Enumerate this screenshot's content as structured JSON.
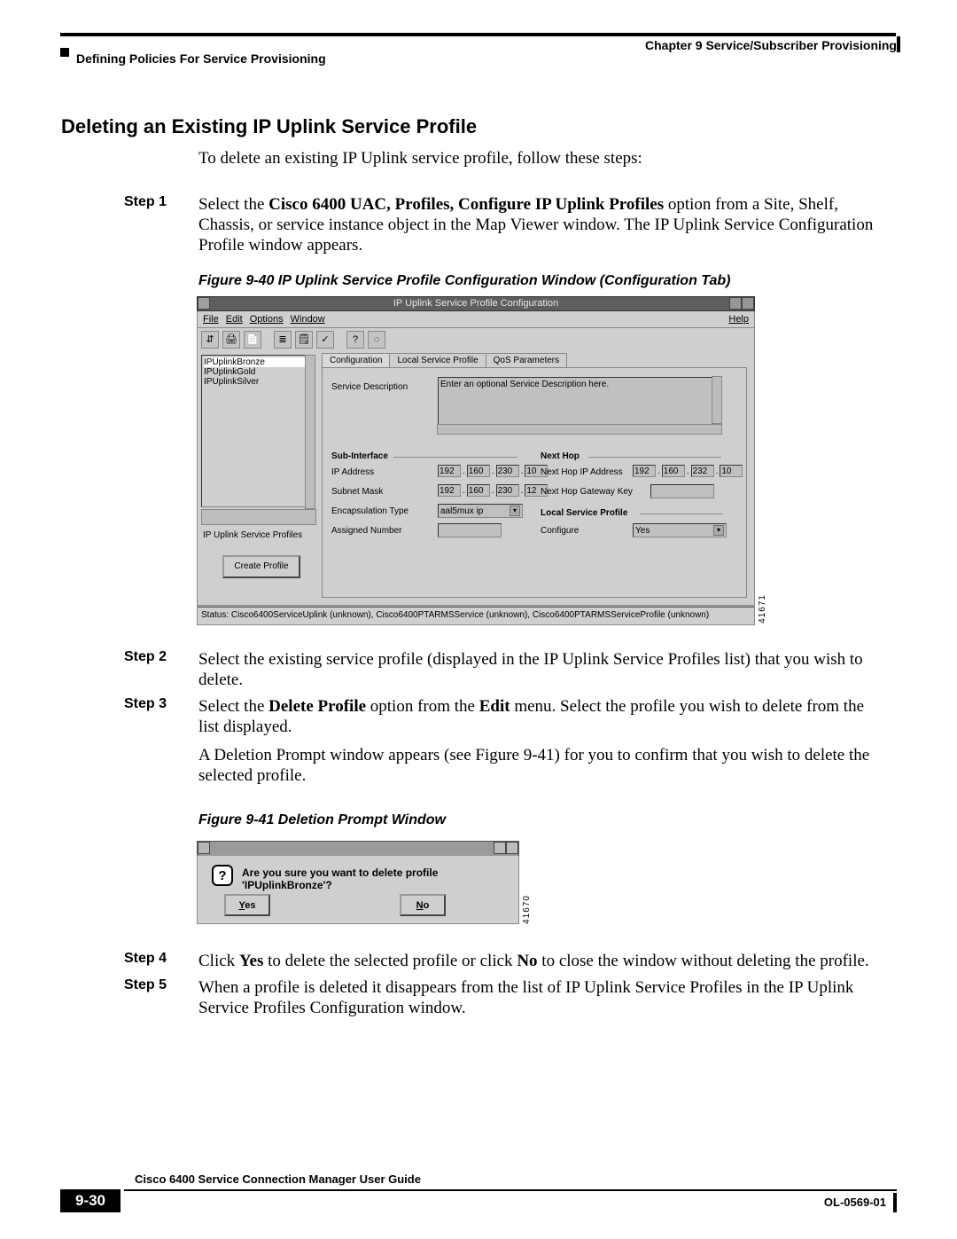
{
  "header": {
    "chapter": "Chapter 9    Service/Subscriber Provisioning",
    "section": "Defining Policies For Service Provisioning"
  },
  "heading": "Deleting an Existing IP Uplink Service Profile",
  "intro": "To delete an existing IP Uplink service profile, follow these steps:",
  "steps": {
    "s1_label": "Step 1",
    "s1_a": "Select the ",
    "s1_b": "Cisco 6400 UAC, Profiles, Configure IP Uplink Profiles",
    "s1_c": " option from a Site, Shelf, Chassis, or service instance object in the Map Viewer window. The IP Uplink Service Configuration Profile window appears.",
    "s2_label": "Step 2",
    "s2": "Select the existing service profile (displayed in the IP Uplink Service Profiles list) that you wish to delete.",
    "s3_label": "Step 3",
    "s3_a": "Select the ",
    "s3_b": "Delete Profile",
    "s3_c": " option from the ",
    "s3_d": "Edit",
    "s3_e": " menu. Select the profile you wish to delete from the list displayed.",
    "s3_p2": "A Deletion Prompt window appears (see Figure 9-41) for you to confirm that you wish to delete the selected profile.",
    "s4_label": "Step 4",
    "s4_a": "Click ",
    "s4_b": "Yes",
    "s4_c": " to delete the selected profile or click ",
    "s4_d": "No",
    "s4_e": " to close the window without deleting the profile.",
    "s5_label": "Step 5",
    "s5": "When a profile is deleted it disappears from the list of IP Uplink Service Profiles in the IP Uplink Service Profiles Configuration window."
  },
  "fig940": "Figure 9-40   IP Uplink Service Profile Configuration Window (Configuration Tab)",
  "fig941": "Figure 9-41   Deletion Prompt Window",
  "shot1": {
    "title": "IP Uplink Service Profile Configuration",
    "menu": {
      "file": "File",
      "edit": "Edit",
      "options": "Options",
      "window": "Window",
      "help": "Help"
    },
    "toolbar_icons": [
      "⇵",
      "🖨",
      "📄",
      "≣",
      "🗒",
      "✓",
      "?",
      "◌"
    ],
    "profiles": {
      "sel": "IPUplinkBronze",
      "p2": "IPUplinkGold",
      "p3": "IPUplinkSilver"
    },
    "left_label": "IP Uplink Service Profiles",
    "create_btn": "Create Profile",
    "tabs": {
      "t1": "Configuration",
      "t2": "Local Service Profile",
      "t3": "QoS Parameters"
    },
    "panel": {
      "svc_desc_label": "Service Description",
      "svc_desc_value": "Enter an optional Service Description here.",
      "sub_if": "Sub-Interface",
      "ip_addr": "IP Address",
      "subnet": "Subnet Mask",
      "encap": "Encapsulation Type",
      "encap_val": "aal5mux ip",
      "assigned": "Assigned Number",
      "next_hop": "Next Hop",
      "nh_ip": "Next Hop IP Address",
      "nh_key": "Next Hop Gateway Key",
      "lsp": "Local Service Profile",
      "configure": "Configure",
      "configure_val": "Yes",
      "ip_octets": [
        "192",
        "160",
        "230",
        "10"
      ],
      "mask_octets": [
        "192",
        "160",
        "230",
        "12"
      ],
      "nh_octets": [
        "192",
        "160",
        "232",
        "10"
      ]
    },
    "status": "Status: Cisco6400ServiceUplink (unknown), Cisco6400PTARMSService (unknown), Cisco6400PTARMSServiceProfile (unknown)",
    "img_id": "41671"
  },
  "shot2": {
    "msg": "Are you sure you want to delete profile 'IPUplinkBronze'?",
    "yes": "Yes",
    "no": "No",
    "yes_u": "Y",
    "no_u": "N",
    "yes_rest": "es",
    "no_rest": "o",
    "img_id": "41670"
  },
  "footer": {
    "book": "Cisco 6400 Service Connection Manager User Guide",
    "page": "9-30",
    "docid": "OL-0569-01"
  }
}
